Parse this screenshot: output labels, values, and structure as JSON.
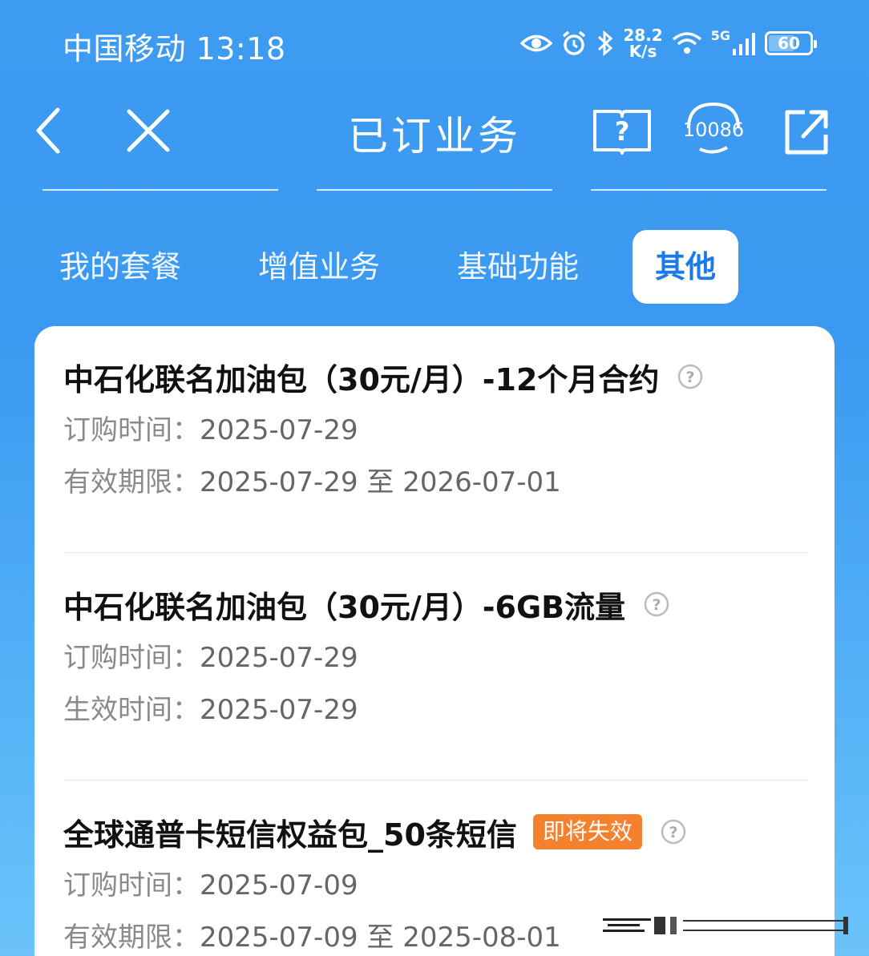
{
  "status_bar": {
    "carrier_time": "中国移动 13:18",
    "net_speed_value": "28.2",
    "net_speed_unit": "K/s",
    "signal_label": "5G",
    "battery_level": "60"
  },
  "nav": {
    "title": "已订业务",
    "service_number": "10086",
    "icons": [
      "back-icon",
      "close-icon",
      "help-book-icon",
      "customer-service-icon",
      "share-icon"
    ]
  },
  "tabs": [
    {
      "label": "我的套餐",
      "active": false
    },
    {
      "label": "增值业务",
      "active": false
    },
    {
      "label": "基础功能",
      "active": false
    },
    {
      "label": "其他",
      "active": true
    }
  ],
  "items": [
    {
      "name": "中石化联名加油包（30元/月）-12个月合约",
      "badge": "",
      "rows": [
        {
          "label": "订购时间：",
          "value": "2025-07-29"
        },
        {
          "label": "有效期限：",
          "value": "2025-07-29 至 2026-07-01"
        }
      ]
    },
    {
      "name": "中石化联名加油包（30元/月）-6GB流量",
      "badge": "",
      "rows": [
        {
          "label": "订购时间：",
          "value": "2025-07-29"
        },
        {
          "label": "生效时间：",
          "value": "2025-07-29"
        }
      ]
    },
    {
      "name": "全球通普卡短信权益包_50条短信",
      "badge": "即将失效",
      "rows": [
        {
          "label": "订购时间：",
          "value": "2025-07-09"
        },
        {
          "label": "有效期限：",
          "value": "2025-07-09 至 2025-08-01"
        }
      ]
    }
  ],
  "colors": {
    "background": "#3b99f1",
    "active_tab_text": "#1a7ae8",
    "badge": "#f5812e"
  }
}
